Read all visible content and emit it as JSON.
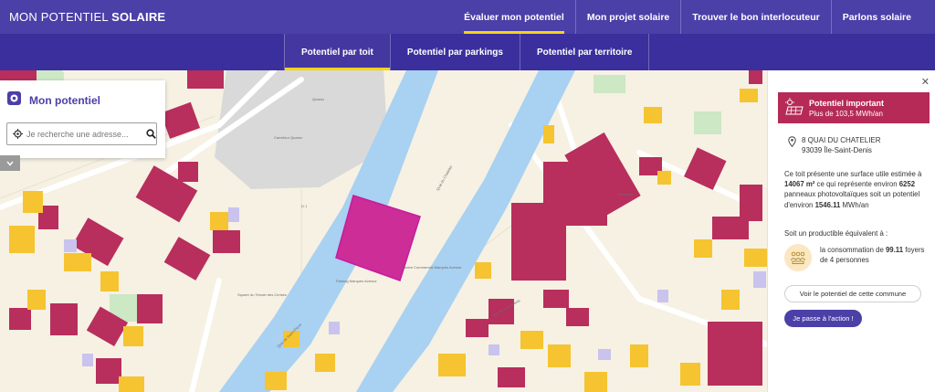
{
  "header": {
    "brand_light": "MON POTENTIEL",
    "brand_bold": "SOLAIRE",
    "nav": [
      {
        "label": "Évaluer mon potentiel",
        "active": true
      },
      {
        "label": "Mon projet solaire",
        "active": false
      },
      {
        "label": "Trouver le bon interlocuteur",
        "active": false
      },
      {
        "label": "Parlons solaire",
        "active": false
      }
    ]
  },
  "subnav": {
    "tabs": [
      {
        "label": "Potentiel par toit",
        "active": true
      },
      {
        "label": "Potentiel par parkings",
        "active": false
      },
      {
        "label": "Potentiel par territoire",
        "active": false
      }
    ]
  },
  "search": {
    "title": "Mon potentiel",
    "placeholder": "Je recherche une adresse..."
  },
  "map": {
    "labels": {
      "carrefour": "Carrefour Quarez",
      "quarez": "Quarez",
      "parking": "Parking Marques Avenue",
      "centre": "Centre Commercial Marques Avenue",
      "square": "Square du Terrain des Cerises",
      "universite": "Université",
      "quai_chatelier": "Quai du Chatelier",
      "quai_saint_pierre": "Quai de Saint-Pierre",
      "rue_saint_denis": "Rue de Saint-Denis",
      "route_d1": "D 1"
    }
  },
  "panel": {
    "close": "✕",
    "potential_title": "Potentiel important",
    "potential_sub": "Plus de 103,5 MWh/an",
    "address_line1": "8 QUAI DU CHATELIER",
    "address_line2": "93039 Île-Saint-Denis",
    "desc_1": "Ce toit présente une surface utile estimée à ",
    "surface": "14067 m²",
    "desc_2": " ce qui représente environ ",
    "panels": "6252",
    "desc_3": " panneaux photovoltaïques soit un potentiel d'environ ",
    "energy": "1546.11",
    "desc_4": " MWh/an",
    "equiv_label": "Soit un productible équivalent à :",
    "foyer_1": "la consommation de ",
    "foyers": "99.11",
    "foyer_2": " foyers de 4 personnes",
    "commune_button": "Voir le potentiel de cette commune",
    "action_button": "Je passe à l'action !"
  },
  "colors": {
    "header": "#4b3fa8",
    "subheader": "#3a2f9d",
    "accent_yellow": "#f6d313",
    "potential_red": "#b52a56",
    "selected_roof": "#cc2d97",
    "roof_red": "#b82e5d",
    "roof_yellow": "#f5c430",
    "river": "#a9d1f1",
    "land": "#f6f1e3"
  }
}
